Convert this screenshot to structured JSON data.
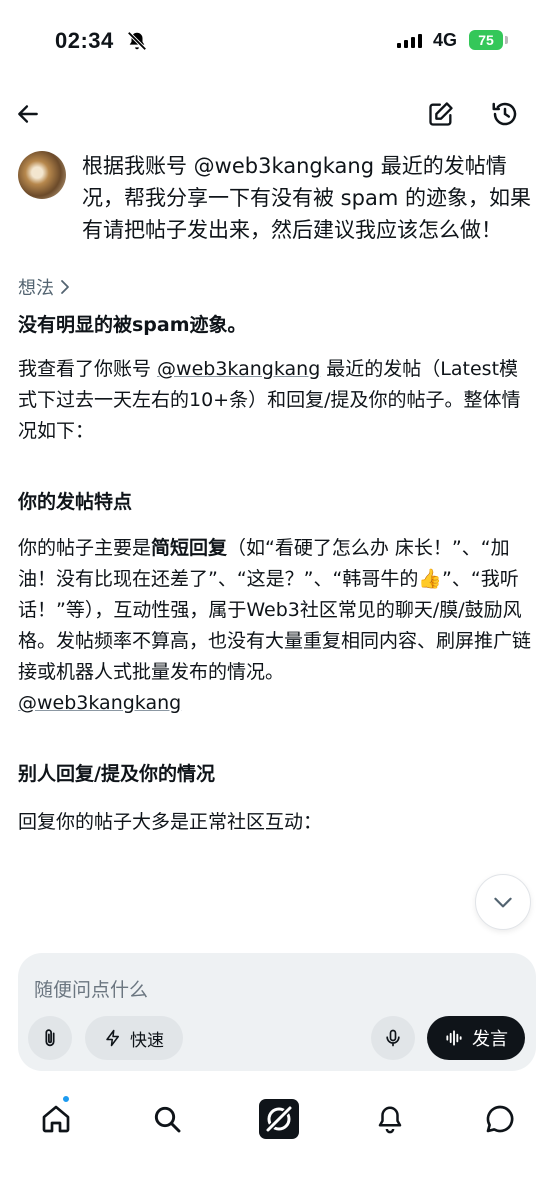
{
  "status_bar": {
    "time": "02:34",
    "network": "4G",
    "battery": "75"
  },
  "conversation": {
    "user_message": "根据我账号 @web3kangkang 最近的发帖情况，帮我分享一下有没有被 spam 的迹象，如果有请把帖子发出来，然后建议我应该怎么做！",
    "thoughts_label": "想法",
    "summary": "没有明显的被spam迹象。",
    "intro_prefix": "我查看了你账号 ",
    "intro_mention": "@web3kangkang",
    "intro_suffix": " 最近的发帖（Latest模式下过去一天左右的10+条）和回复/提及你的帖子。整体情况如下：",
    "section1_heading": "你的发帖特点",
    "section1_p1": "你的帖子主要是",
    "section1_bold": "简短回复",
    "section1_p2": "（如“看硬了怎么办 床长！”、“加油！没有比现在还差了”、“这是？”、“韩哥牛的",
    "section1_emoji": "👍",
    "section1_p3": "”、“我听话！”等），互动性强，属于Web3社区常见的聊天/膜/鼓励风格。发帖频率不算高，也没有大量重复相同内容、刷屏推广链接或机器人式批量发布的情况。",
    "section1_mention": "@web3kangkang",
    "section2_heading": "别人回复/提及你的情况",
    "section2_text": "回复你的帖子大多是正常社区互动："
  },
  "composer": {
    "placeholder": "随便问点什么",
    "mode_label": "快速",
    "speak_label": "发言"
  },
  "icons": {
    "back": "back-arrow-icon",
    "edit": "compose-icon",
    "history": "history-icon",
    "attach": "paperclip-icon",
    "mic": "microphone-icon",
    "home": "home-icon",
    "search": "search-icon",
    "grok": "grok-icon",
    "notifications": "bell-icon",
    "messages": "chat-bubble-icon"
  }
}
